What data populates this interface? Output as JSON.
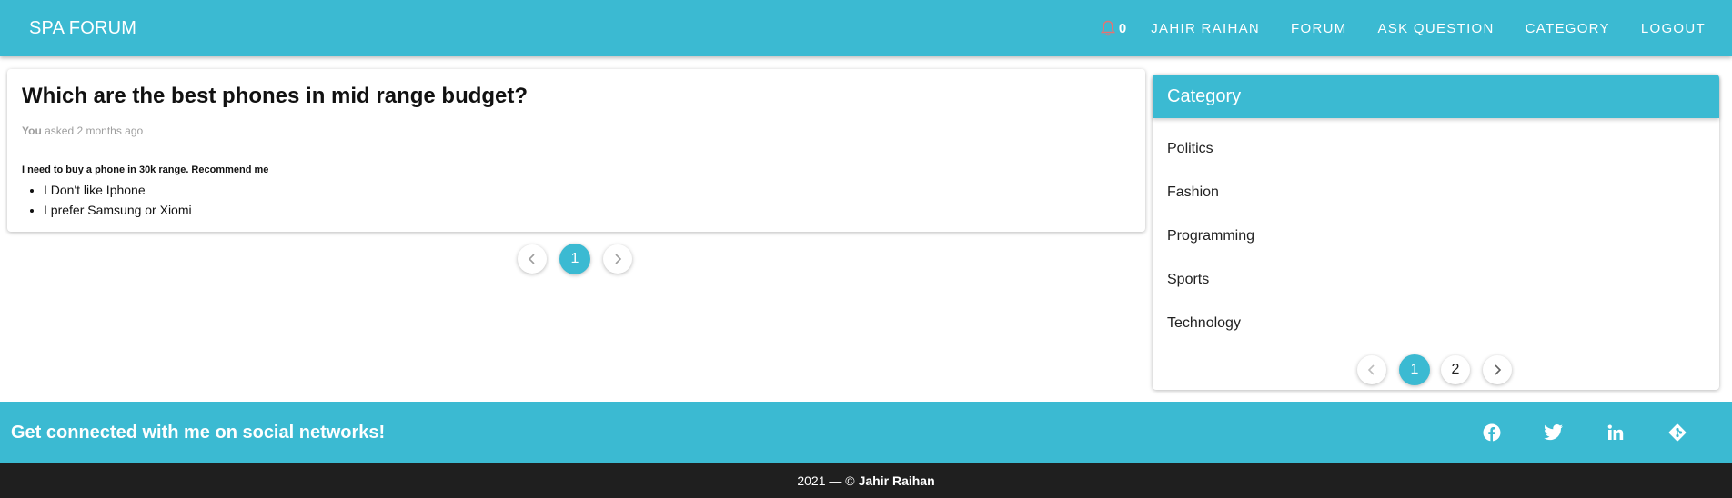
{
  "header": {
    "brand": "SPA FORUM",
    "notification_count": "0",
    "nav": [
      "JAHIR RAIHAN",
      "FORUM",
      "ASK QUESTION",
      "CATEGORY",
      "LOGOUT"
    ]
  },
  "question": {
    "title": "Which are the best phones in mid range budget?",
    "author": "You",
    "asked_text": "asked 2 months ago",
    "body_heading": "I need to buy a phone in 30k range. Recommend me",
    "body_list": [
      "I Don't like Iphone",
      "I prefer Samsung or Xiomi"
    ]
  },
  "question_pagination": {
    "current": "1"
  },
  "categories": {
    "title": "Category",
    "items": [
      "Politics",
      "Fashion",
      "Programming",
      "Sports",
      "Technology"
    ],
    "pagination": {
      "pages": [
        "1",
        "2"
      ],
      "current": "1"
    }
  },
  "footer": {
    "social_text": "Get connected with me on social networks!",
    "social_icons": [
      "facebook-icon",
      "twitter-icon",
      "linkedin-icon",
      "git-icon"
    ],
    "copyright_prefix": "2021 — ©",
    "copyright_name": "Jahir Raihan"
  },
  "colors": {
    "accent": "#3bbad2",
    "footer_dark": "#1f1f1f",
    "notif_icon": "#e57373"
  }
}
